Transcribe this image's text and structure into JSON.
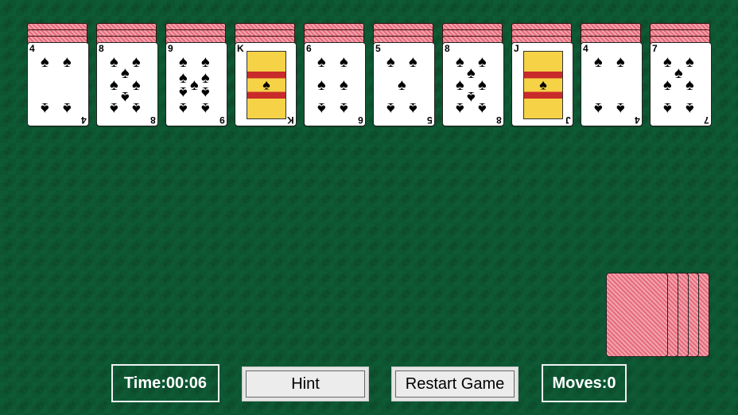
{
  "game": {
    "time_label": "Time:00:06",
    "moves_label": "Moves:0",
    "hint_button": "Hint",
    "restart_button": "Restart Game",
    "suit_symbol": "♠",
    "colors": {
      "felt": "#0e5a34",
      "card_back": "#e56b7b",
      "status_border": "#f2f2f2"
    }
  },
  "tableau": [
    {
      "facedown_count": 3,
      "rank": "4"
    },
    {
      "facedown_count": 3,
      "rank": "8"
    },
    {
      "facedown_count": 3,
      "rank": "9"
    },
    {
      "facedown_count": 3,
      "rank": "K"
    },
    {
      "facedown_count": 3,
      "rank": "6"
    },
    {
      "facedown_count": 3,
      "rank": "5"
    },
    {
      "facedown_count": 3,
      "rank": "8"
    },
    {
      "facedown_count": 3,
      "rank": "J"
    },
    {
      "facedown_count": 3,
      "rank": "4"
    },
    {
      "facedown_count": 3,
      "rank": "7"
    }
  ],
  "stock": {
    "card_count": 5
  }
}
